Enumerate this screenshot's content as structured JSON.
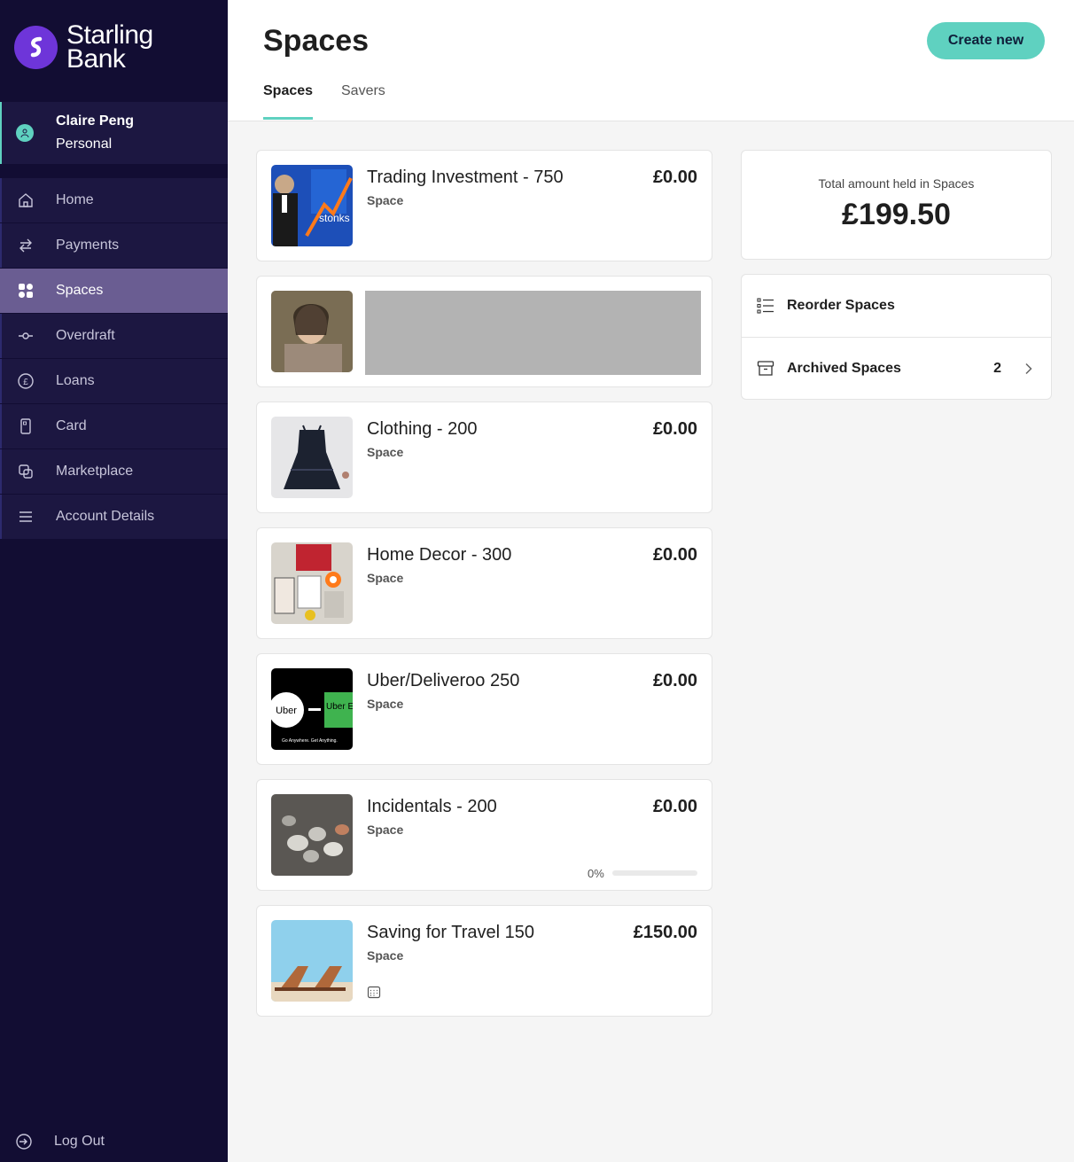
{
  "brand": {
    "name_line1": "Starling",
    "name_line2": "Bank",
    "accent": "#5fd1c0",
    "sidebar_bg": "#120d33"
  },
  "account": {
    "name": "Claire Peng",
    "type": "Personal"
  },
  "nav": [
    {
      "label": "Home",
      "icon": "home-icon"
    },
    {
      "label": "Payments",
      "icon": "transfer-arrows-icon"
    },
    {
      "label": "Spaces",
      "icon": "grid-icon",
      "active": true
    },
    {
      "label": "Overdraft",
      "icon": "slider-icon"
    },
    {
      "label": "Loans",
      "icon": "pound-circle-icon"
    },
    {
      "label": "Card",
      "icon": "card-icon"
    },
    {
      "label": "Marketplace",
      "icon": "marketplace-icon"
    },
    {
      "label": "Account Details",
      "icon": "list-icon"
    }
  ],
  "logout": {
    "label": "Log Out",
    "icon": "logout-icon"
  },
  "header": {
    "title": "Spaces",
    "create_button": "Create new",
    "tabs": [
      {
        "label": "Spaces",
        "active": true
      },
      {
        "label": "Savers"
      }
    ]
  },
  "spaces": [
    {
      "title": "Trading Investment - 750",
      "subtitle": "Space",
      "amount": "£0.00",
      "thumb": "stonks-meme-image"
    },
    {
      "title": "",
      "subtitle": "",
      "amount": "",
      "thumb": "portrait-photo",
      "redacted": true
    },
    {
      "title": "Clothing - 200",
      "subtitle": "Space",
      "amount": "£0.00",
      "thumb": "dress-photo"
    },
    {
      "title": "Home Decor - 300",
      "subtitle": "Space",
      "amount": "£0.00",
      "thumb": "wall-art-photo"
    },
    {
      "title": "Uber/Deliveroo 250",
      "subtitle": "Space",
      "amount": "£0.00",
      "thumb": "uber-eats-logo"
    },
    {
      "title": "Incidentals - 200",
      "subtitle": "Space",
      "amount": "£0.00",
      "thumb": "coins-photo",
      "progress_label": "0%",
      "progress": 0
    },
    {
      "title": "Saving for Travel 150",
      "subtitle": "Space",
      "amount": "£150.00",
      "thumb": "beach-chairs-photo",
      "icon": "calendar-icon"
    }
  ],
  "summary": {
    "label": "Total amount held in Spaces",
    "amount": "£199.50"
  },
  "options": {
    "reorder_label": "Reorder Spaces",
    "archived_label": "Archived Spaces",
    "archived_count": "2"
  },
  "thumb_text": {
    "stonks": "stonks",
    "uber": "Uber",
    "uber_eats": "Uber Eats",
    "uber_tagline": "Go Anywhere. Get Anything."
  }
}
